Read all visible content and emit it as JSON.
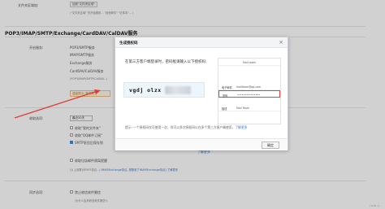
{
  "top_left": {
    "label": "文件夹区域加:",
    "button": "加到\"文件夹区域\"",
    "hint": "(\"文件夹区域\" 的开始顺序... \"其他邮件\" \"记事本\"... )"
  },
  "section": {
    "title": "POP3/IMAP/SMTP/Exchange/CardDAV/CalDAV服务"
  },
  "services": {
    "label": "开启服务:",
    "rows": [
      "POP3/SMTP服务",
      "IMAP/SMTP服务",
      "Exchange服务",
      "CardDAV/CalDAV服务"
    ],
    "note": "(POP3/IMAP/SMTP/CalDAV...)",
    "orange_box": "温馨提示: 登录第三"
  },
  "receive": {
    "label": "收取选项:",
    "days_prefix": "最近30天",
    "options": [
      "收取\"我的文件夹\"",
      "收取\"QQ邮件订阅\"",
      "SMTP发信后保存到",
      "收取垃圾邮件隔离提醒"
    ],
    "link": "了解更多",
    "imap_hint": "(以上设置对POP3协议...)",
    "imap_link": "IMAP/Exchange协议, 按照用了IMAP/Exchange协议)",
    "imap_more": "了解更多"
  },
  "sync": {
    "label": "同步选项:",
    "option": "禁止收信软件删信",
    "note": "(为什么会有收信软件删信?)"
  },
  "modal": {
    "title": "生成授权码",
    "close": "×",
    "instruction": "在第三方客户端登录时，密码框请输入以下授权码:",
    "code": "vgdj olzx",
    "phone": {
      "top": "Mail team",
      "rows": [
        {
          "k": "电子邮件",
          "v": "mailteam@qq.com"
        },
        {
          "k": "密码",
          "v": "•••••••••••••••"
        },
        {
          "k": "描述",
          "v": "Mail Team"
        }
      ]
    },
    "tip": "提示: 一个授权码仅可使用一次，你可以多次授权码以在多个第三方客户端使用，",
    "tip_link": "了解更多",
    "ok": "确定"
  },
  "watermark": "CSDN @...",
  "colors": {
    "accent": "#3a7bd5",
    "arrow": "#e03c31",
    "highlight": "#e84040"
  }
}
